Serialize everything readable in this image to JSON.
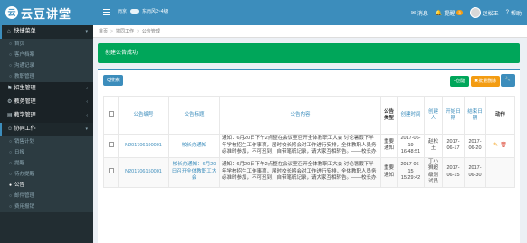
{
  "header": {
    "logo_text": "云豆讲堂",
    "weather_city": "南京",
    "weather_wind": "东南风3~4级",
    "messages": "消息",
    "reminders": "提醒",
    "reminder_count": "3",
    "user_name": "赵松王",
    "help": "帮助"
  },
  "sidebar": {
    "sections": [
      {
        "label": "快捷菜单",
        "open": true,
        "items": [
          "首页",
          "客户档案",
          "沟通记录",
          "教职管理"
        ]
      },
      {
        "label": "招生管理",
        "open": false,
        "items": []
      },
      {
        "label": "教务管理",
        "open": false,
        "items": []
      },
      {
        "label": "教学管理",
        "open": false,
        "items": []
      },
      {
        "label": "协同工作",
        "open": true,
        "items": [
          "销售计划",
          "日报",
          "提醒",
          "待办提醒",
          "公告",
          "邮件管理",
          "费用报销"
        ]
      }
    ],
    "active_item": "公告"
  },
  "breadcrumb": [
    "首页",
    "协同工作",
    "公告管理"
  ],
  "alert": {
    "text": "创建公告成功"
  },
  "toolbar": {
    "search": "Q搜索",
    "add": "+创建",
    "batch": "✖批量删除"
  },
  "table": {
    "headers": [
      "公告编号",
      "公告标题",
      "公告内容",
      "公告类型",
      "创建时间",
      "创建人",
      "开始日期",
      "结束日期",
      "动作"
    ],
    "rows": [
      {
        "id": "N201706190001",
        "title": "校长办通知",
        "content": "通知：6月20日下午2点整在会议室召开全体教职工大会 讨论暑假下半年学校招生工作事项，届时校长将会对工作进行安排，全体教职人员务必准时参加，不可迟到，自带笔纸记录，请大家互相转告。——校长办",
        "type": "重要通知",
        "created": "2017-06-19 16:48:51",
        "creator": "赵松王",
        "start": "2017-06-17",
        "end": "2017-06-20"
      },
      {
        "id": "N201706150001",
        "title": "校长办通知：6月20日召开全体教职工大会",
        "content": "通知：6月20日下午2点整在会议室召开全体教职工大会 讨论暑假下半年学校招生工作事项，届时校长将会对工作进行安排，全体教职人员务必准时参加，不可迟到，自带笔纸记录，请大家互相转告。——校长办",
        "type": "重要通知",
        "created": "2017-06-15 15:29:42",
        "creator": "丁小狮超级测试员",
        "start": "2017-06-15",
        "end": "2017-06-30"
      }
    ]
  },
  "colors": {
    "primary": "#3c8dbc",
    "success": "#00a65a",
    "warning": "#f39c12",
    "danger": "#dd4b39",
    "sidebar": "#222d32"
  }
}
